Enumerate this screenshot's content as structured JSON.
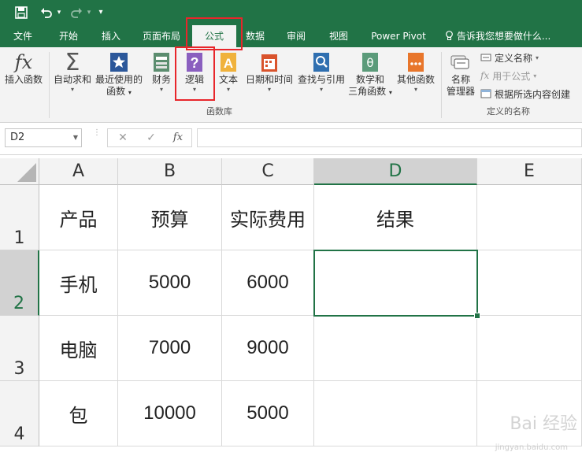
{
  "qat": {
    "save_icon": "save-icon",
    "undo_icon": "undo-icon",
    "redo_icon": "redo-icon",
    "customize_icon": "customize-qat-icon",
    "undo_caret": "▾",
    "redo_caret": "▾",
    "customize_caret": "▾"
  },
  "tabs": [
    "文件",
    "开始",
    "插入",
    "页面布局",
    "公式",
    "数据",
    "审阅",
    "视图",
    "Power Pivot"
  ],
  "tell_me": "告诉我您想要做什么...",
  "ribbon": {
    "insert_function": "插入函数",
    "autosum": "自动求和",
    "recently_used_1": "最近使用的",
    "recently_used_2": "函数",
    "financial": "财务",
    "logical": "逻辑",
    "text": "文本",
    "datetime": "日期和时间",
    "lookup": "查找与引用",
    "math_1": "数学和",
    "math_2": "三角函数",
    "more": "其他函数",
    "name_manager_1": "名称",
    "name_manager_2": "管理器",
    "define_name": "定义名称",
    "use_in_formula": "用于公式",
    "create_from_selection": "根据所选内容创建",
    "group_function_library": "函数库",
    "group_defined_names": "定义的名称",
    "caret": "▾"
  },
  "formula_bar": {
    "name_box": "D2",
    "cancel": "✕",
    "enter": "✓",
    "fx": "fx",
    "formula": ""
  },
  "columns": [
    "A",
    "B",
    "C",
    "D",
    "E"
  ],
  "rows": [
    {
      "num": "1",
      "cells": [
        "产品",
        "预算",
        "实际费用",
        "结果",
        ""
      ]
    },
    {
      "num": "2",
      "cells": [
        "手机",
        "5000",
        "6000",
        "",
        ""
      ]
    },
    {
      "num": "3",
      "cells": [
        "电脑",
        "7000",
        "9000",
        "",
        ""
      ]
    },
    {
      "num": "4",
      "cells": [
        "包",
        "10000",
        "5000",
        "",
        ""
      ]
    }
  ],
  "selected_cell": "D2",
  "watermark": "Bai 经验",
  "watermark_url": "jingyan.baidu.com",
  "colors": {
    "excel_green": "#217346",
    "highlight_red": "#e8262b"
  }
}
